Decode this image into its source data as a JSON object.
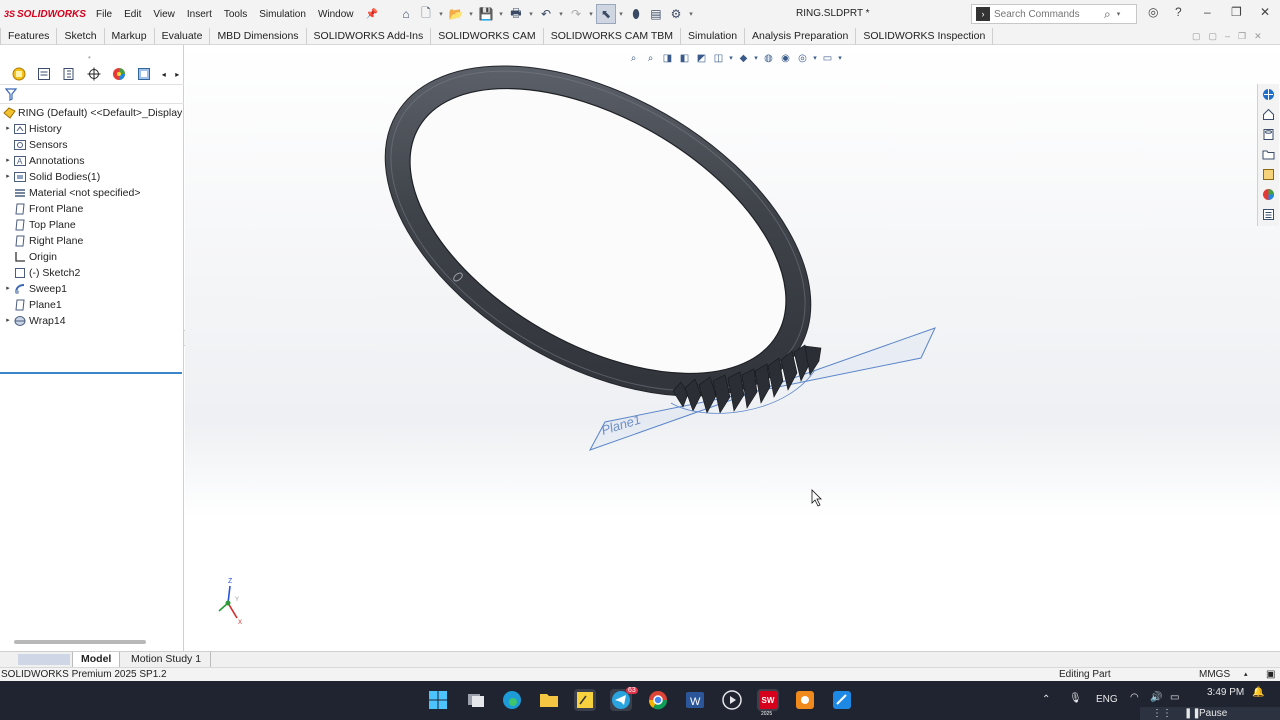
{
  "app": {
    "brand": "SOLIDWORKS",
    "document_title": "RING.SLDPRT *",
    "menu": [
      "File",
      "Edit",
      "View",
      "Insert",
      "Tools",
      "Simulation",
      "Window"
    ],
    "search_placeholder": "Search Commands"
  },
  "command_tabs": [
    "Features",
    "Sketch",
    "Markup",
    "Evaluate",
    "MBD Dimensions",
    "SOLIDWORKS Add-Ins",
    "SOLIDWORKS CAM",
    "SOLIDWORKS CAM TBM",
    "Simulation",
    "Analysis Preparation",
    "SOLIDWORKS Inspection"
  ],
  "feature_tree": {
    "root": "RING (Default) <<Default>_Display S",
    "items": [
      {
        "label": "History",
        "icon": "history-folder-icon",
        "expandable": true
      },
      {
        "label": "Sensors",
        "icon": "sensors-icon",
        "expandable": false
      },
      {
        "label": "Annotations",
        "icon": "annotations-icon",
        "expandable": true
      },
      {
        "label": "Solid Bodies(1)",
        "icon": "solid-bodies-icon",
        "expandable": true
      },
      {
        "label": "Material <not specified>",
        "icon": "material-icon",
        "expandable": false
      },
      {
        "label": "Front Plane",
        "icon": "plane-icon",
        "expandable": false
      },
      {
        "label": "Top Plane",
        "icon": "plane-icon",
        "expandable": false
      },
      {
        "label": "Right Plane",
        "icon": "plane-icon",
        "expandable": false
      },
      {
        "label": "Origin",
        "icon": "origin-icon",
        "expandable": false
      },
      {
        "label": "(-) Sketch2",
        "icon": "sketch-icon",
        "expandable": false
      },
      {
        "label": "Sweep1",
        "icon": "sweep-icon",
        "expandable": true
      },
      {
        "label": "Plane1",
        "icon": "plane-icon",
        "expandable": false
      },
      {
        "label": "Wrap14",
        "icon": "wrap-icon",
        "expandable": true
      }
    ]
  },
  "graphics": {
    "plane_label": "Plane1",
    "triad": {
      "z": "Z",
      "y": "Y",
      "x": "X"
    }
  },
  "bottom_tabs": {
    "model": "Model",
    "motion": "Motion Study 1"
  },
  "status": {
    "product": "SOLIDWORKS Premium 2025 SP1.2",
    "mode": "Editing Part",
    "units": "MMGS"
  },
  "taskbar": {
    "language": "ENG",
    "time": "3:49 PM",
    "media": "Pause",
    "badge": "63",
    "sw_label": "2025"
  },
  "colors": {
    "brand_red": "#d6001c",
    "ring_dark": "#3b3f46",
    "plane_blue": "#5b86c9",
    "selection_blue": "#3a86c8",
    "taskbar_bg": "#1f2430"
  }
}
